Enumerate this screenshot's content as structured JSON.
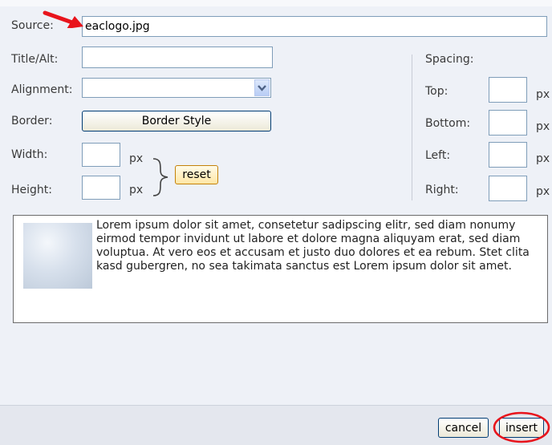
{
  "source": {
    "label": "Source:",
    "value": "eaclogo.jpg"
  },
  "title_alt": {
    "label": "Title/Alt:",
    "value": ""
  },
  "alignment": {
    "label": "Alignment:",
    "value": ""
  },
  "border": {
    "label": "Border:",
    "button": "Border Style"
  },
  "width": {
    "label": "Width:",
    "value": "",
    "unit": "px"
  },
  "height": {
    "label": "Height:",
    "value": "",
    "unit": "px"
  },
  "reset_button": "reset",
  "spacing": {
    "title": "Spacing:",
    "top": {
      "label": "Top:",
      "value": "",
      "unit": "px"
    },
    "bottom": {
      "label": "Bottom:",
      "value": "",
      "unit": "px"
    },
    "left": {
      "label": "Left:",
      "value": "",
      "unit": "px"
    },
    "right": {
      "label": "Right:",
      "value": "",
      "unit": "px"
    }
  },
  "preview": {
    "text": "Lorem ipsum dolor sit amet, consetetur sadipscing elitr, sed diam nonumy eirmod tempor invidunt ut labore et dolore magna aliquyam erat, sed diam voluptua. At vero eos et accusam et justo duo dolores et ea rebum. Stet clita kasd gubergren, no sea takimata sanctus est Lorem ipsum dolor sit amet."
  },
  "footer": {
    "cancel": "cancel",
    "insert": "insert"
  },
  "colors": {
    "annotation": "#e8141c",
    "panel": "#eef1f7",
    "input_border": "#7f9db9"
  }
}
